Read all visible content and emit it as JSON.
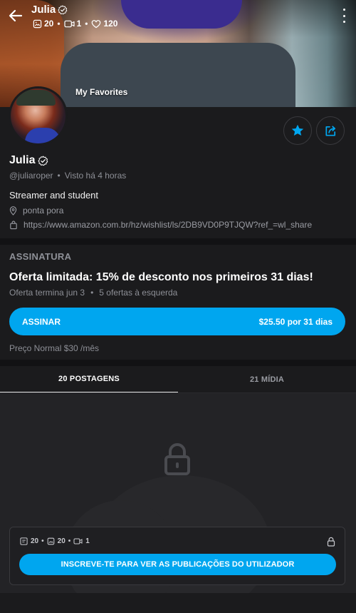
{
  "colors": {
    "accent": "#00a6ef",
    "background": "#1b1b1d",
    "muted_text": "#8d8f96"
  },
  "header": {
    "name": "Julia",
    "stats": {
      "photos": "20",
      "videos": "1",
      "likes": "120"
    },
    "cover_label": "My Favorites"
  },
  "profile": {
    "name": "Julia",
    "username": "@juliaroper",
    "last_seen": "Visto  há 4 horas",
    "bio": "Streamer and student",
    "location": "ponta pora",
    "website": "https://www.amazon.com.br/hz/wishlist/ls/2DB9VD0P9TJQW?ref_=wl_share"
  },
  "subscription": {
    "title": "ASSINATURA",
    "offer": "Oferta limitada: 15% de desconto nos primeiros 31 dias!",
    "offer_ends": "Oferta termina jun 3",
    "offers_left": "5 ofertas à esquerda",
    "button_label": "ASSINAR",
    "button_price": "$25.50 por 31 dias",
    "normal_price": "Preço Normal $30 /mês"
  },
  "tabs": [
    {
      "label": "20 POSTAGENS",
      "active": true
    },
    {
      "label": "21 MÍDIA",
      "active": false
    }
  ],
  "locked_card": {
    "posts": "20",
    "photos": "20",
    "videos": "1",
    "button_label": "INSCREVE-TE PARA VER AS PUBLICAÇÕES DO UTILIZADOR"
  },
  "icons": [
    "back-arrow-icon",
    "verified-icon",
    "image-icon",
    "video-icon",
    "heart-icon",
    "more-vertical-icon",
    "star-icon",
    "share-icon",
    "location-pin-icon",
    "shopping-bag-icon",
    "lock-icon",
    "post-icon"
  ]
}
